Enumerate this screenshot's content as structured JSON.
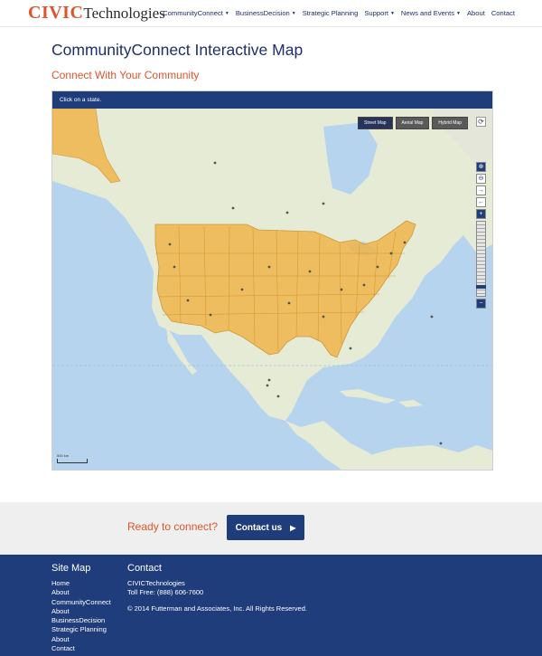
{
  "header": {
    "logo_civic": "CIVIC",
    "logo_tech": "Technologies",
    "nav": [
      {
        "label": "CommunityConnect",
        "dropdown": true
      },
      {
        "label": "BusinessDecision",
        "dropdown": true
      },
      {
        "label": "Strategic Planning",
        "dropdown": false
      },
      {
        "label": "Support",
        "dropdown": true
      },
      {
        "label": "News and Events",
        "dropdown": true
      },
      {
        "label": "About",
        "dropdown": false
      },
      {
        "label": "Contact",
        "dropdown": false
      }
    ]
  },
  "page": {
    "title": "CommunityConnect Interactive Map",
    "subtitle": "Connect With Your Community"
  },
  "map": {
    "instruction": "Click on a state.",
    "types": [
      "Street Map",
      "Aerial Map",
      "Hybrid Map"
    ],
    "active_type": "Street Map",
    "scale_label": "500 km",
    "controls": [
      "zoom-in-magnifier-icon",
      "zoom-out-magnifier-icon",
      "pan-right-arrow-icon",
      "pan-left-arrow-icon",
      "plus-icon",
      "minus-icon",
      "refresh-icon"
    ],
    "colors": {
      "water": "#b6d4ee",
      "land": "#e6ebd6",
      "highlight": "#f0b54b",
      "highlight_border": "#c98a1c"
    }
  },
  "cta": {
    "text": "Ready to connect?",
    "button": "Contact us"
  },
  "footer": {
    "sitemap_heading": "Site Map",
    "sitemap_links": [
      "Home",
      "About",
      "CommunityConnect",
      "About",
      "BusinessDecision",
      "Strategic Planning",
      "About",
      "Contact"
    ],
    "contact_heading": "Contact",
    "company": "CIVICTechnologies",
    "phone": "Toll Free: (888) 606-7600",
    "copyright": "© 2014 Futterman and Associates, Inc. All Rights Reserved."
  }
}
